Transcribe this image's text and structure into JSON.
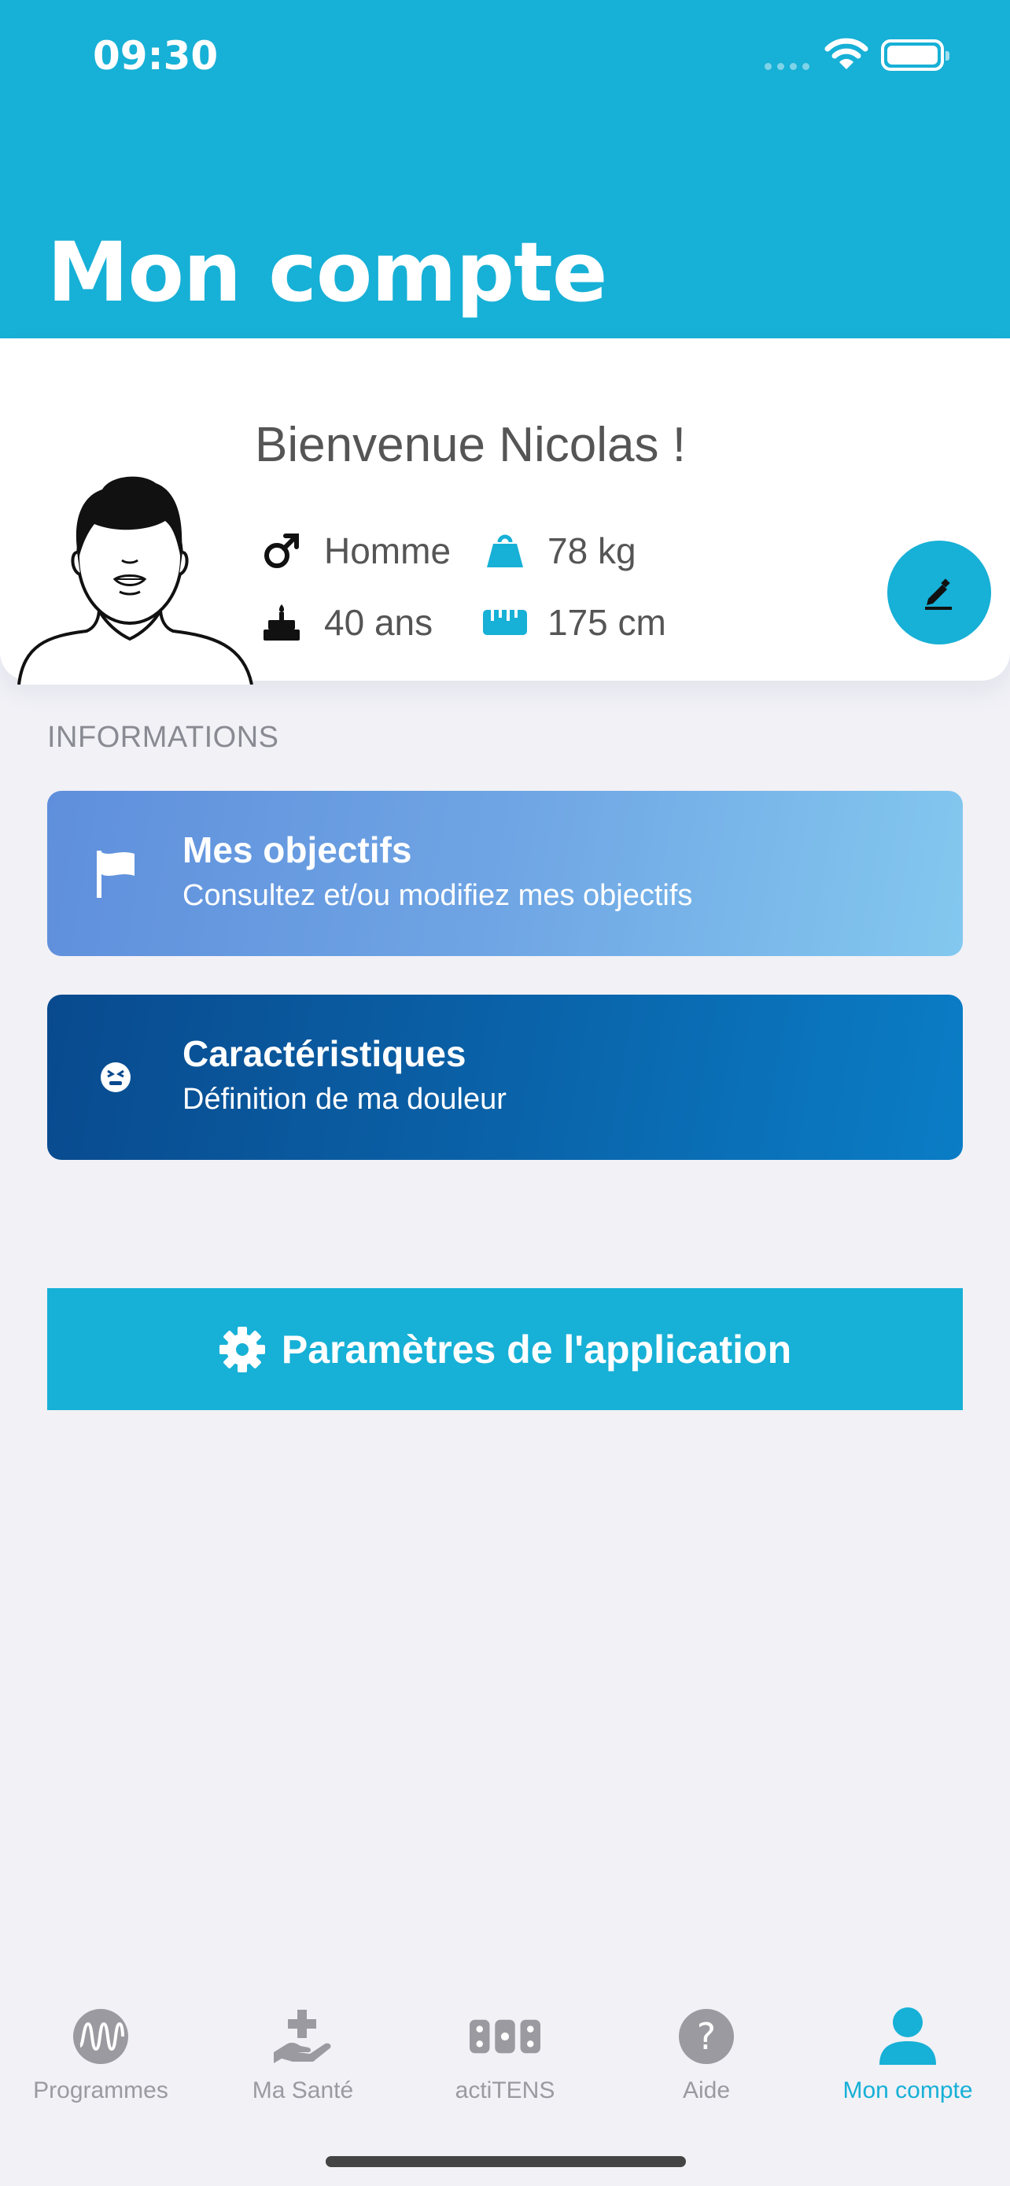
{
  "status_bar": {
    "time": "09:30"
  },
  "header": {
    "title": "Mon compte"
  },
  "profile": {
    "welcome": "Bienvenue Nicolas !",
    "gender": "Homme",
    "weight": "78 kg",
    "age": "40 ans",
    "height": "175 cm"
  },
  "informations": {
    "section_label": "INFORMATIONS",
    "cards": [
      {
        "title": "Mes objectifs",
        "subtitle": "Consultez et/ou modifiez mes objectifs",
        "icon": "flag-icon"
      },
      {
        "title": "Caractéristiques",
        "subtitle": "Définition de ma douleur",
        "icon": "pain-face-icon"
      }
    ]
  },
  "settings_button": {
    "label": "Paramètres de l'application",
    "icon": "gear-icon"
  },
  "tabbar": {
    "tabs": [
      {
        "label": "Programmes",
        "icon": "programmes-wave-icon",
        "active": false
      },
      {
        "label": "Ma Santé",
        "icon": "health-hand-icon",
        "active": false
      },
      {
        "label": "actiTENS",
        "icon": "tens-device-icon",
        "active": false
      },
      {
        "label": "Aide",
        "icon": "help-icon",
        "active": false
      },
      {
        "label": "Mon compte",
        "icon": "user-icon",
        "active": true
      }
    ]
  },
  "colors": {
    "accent": "#17b0d6",
    "card_objectifs": "#6fa5e4",
    "card_caracteristiques": "#0a62a8",
    "inactive_tab": "#9a9aa0"
  }
}
